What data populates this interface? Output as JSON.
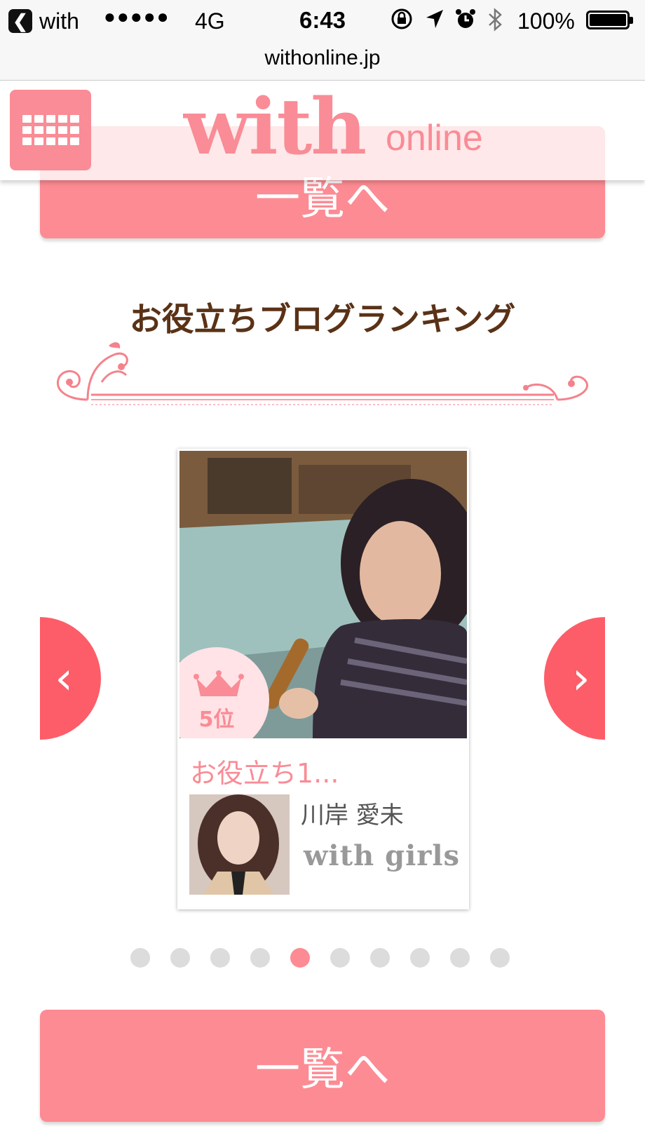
{
  "status_bar": {
    "back_app": "with",
    "signal": "●●●●●",
    "network": "4G",
    "time": "6:43",
    "battery": "100%"
  },
  "url_bar": {
    "url": "withonline.jp"
  },
  "header": {
    "logo_main": "with",
    "logo_sub": "online",
    "menu_icon": "grid-menu-icon"
  },
  "top_button": {
    "label": "一覧へ"
  },
  "section": {
    "title": "お役立ちブログランキング"
  },
  "carousel": {
    "prev_label": "‹",
    "next_label": "›",
    "card": {
      "rank": "5位",
      "title": "お役立ち1...",
      "author_name": "川岸 愛未",
      "author_brand": "with girls"
    },
    "dots": {
      "count": 10,
      "active_index": 4
    }
  },
  "bottom_button": {
    "label": "一覧へ"
  },
  "colors": {
    "accent": "#fd8b93",
    "arrow": "#fd5d68",
    "title": "#5a3217",
    "dot": "#dcdcdc"
  }
}
